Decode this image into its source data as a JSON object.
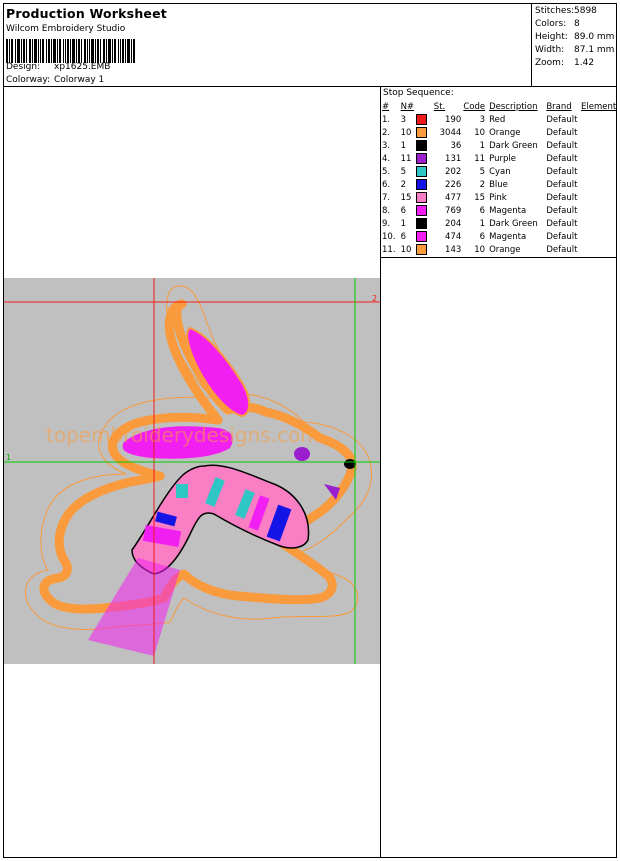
{
  "header": {
    "title": "Production Worksheet",
    "app": "Wilcom Embroidery Studio",
    "design_label": "Design:",
    "design_value": "xp1625.EMB",
    "colorway_label": "Colorway:",
    "colorway_value": "Colorway 1"
  },
  "stats": [
    {
      "label": "Stitches:",
      "value": "5898"
    },
    {
      "label": "Colors:",
      "value": "8"
    },
    {
      "label": "Height:",
      "value": "89.0 mm"
    },
    {
      "label": "Width:",
      "value": "87.1 mm"
    },
    {
      "label": "Zoom:",
      "value": "1.42"
    }
  ],
  "stop_sequence": {
    "title": "Stop Sequence:",
    "headers": {
      "idx": "#",
      "n": "N#",
      "st": "St.",
      "code": "Code",
      "desc": "Description",
      "brand": "Brand",
      "element": "Element"
    },
    "rows": [
      {
        "idx": "1.",
        "n": "3",
        "color": "#ef1b1b",
        "st": "190",
        "code": "3",
        "desc": "Red",
        "brand": "Default"
      },
      {
        "idx": "2.",
        "n": "10",
        "color": "#f99a3c",
        "st": "3044",
        "code": "10",
        "desc": "Orange",
        "brand": "Default"
      },
      {
        "idx": "3.",
        "n": "1",
        "color": "#000000",
        "st": "36",
        "code": "1",
        "desc": "Dark Green",
        "brand": "Default"
      },
      {
        "idx": "4.",
        "n": "11",
        "color": "#9b1fcf",
        "st": "131",
        "code": "11",
        "desc": "Purple",
        "brand": "Default"
      },
      {
        "idx": "5.",
        "n": "5",
        "color": "#2fc6c6",
        "st": "202",
        "code": "5",
        "desc": "Cyan",
        "brand": "Default"
      },
      {
        "idx": "6.",
        "n": "2",
        "color": "#1414e6",
        "st": "226",
        "code": "2",
        "desc": "Blue",
        "brand": "Default"
      },
      {
        "idx": "7.",
        "n": "15",
        "color": "#f97ec3",
        "st": "477",
        "code": "15",
        "desc": "Pink",
        "brand": "Default"
      },
      {
        "idx": "8.",
        "n": "6",
        "color": "#f21ff2",
        "st": "769",
        "code": "6",
        "desc": "Magenta",
        "brand": "Default"
      },
      {
        "idx": "9.",
        "n": "1",
        "color": "#000000",
        "st": "204",
        "code": "1",
        "desc": "Dark Green",
        "brand": "Default"
      },
      {
        "idx": "10.",
        "n": "6",
        "color": "#f21ff2",
        "st": "474",
        "code": "6",
        "desc": "Magenta",
        "brand": "Default"
      },
      {
        "idx": "11.",
        "n": "10",
        "color": "#f99a3c",
        "st": "143",
        "code": "10",
        "desc": "Orange",
        "brand": "Default"
      }
    ]
  },
  "design_preview": {
    "watermark": "topembroiderydesigns.com",
    "marker_1": "1",
    "marker_2": "2",
    "background": "#c0c0c0",
    "thread_colors": {
      "orange": "#f99a3c",
      "magenta": "#f21ff2",
      "pink": "#f97ec3",
      "cyan": "#2fc6c6",
      "blue": "#1414e6",
      "purple": "#9b1fcf",
      "black": "#000000",
      "red": "#ef1b1b",
      "guide_green": "#00cc00"
    }
  }
}
